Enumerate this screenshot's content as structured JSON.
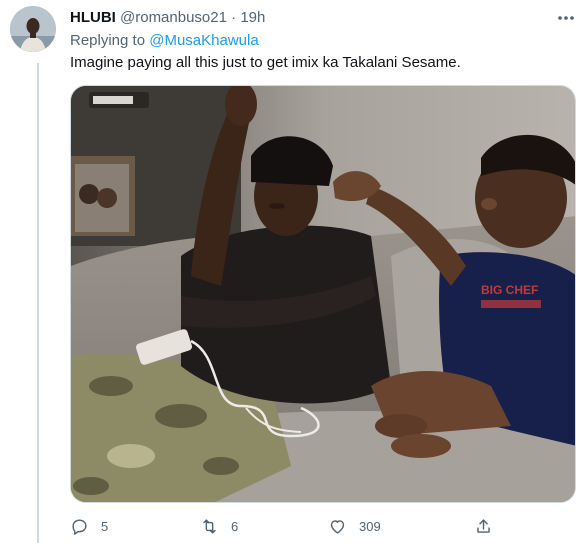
{
  "tweet": {
    "display_name": "HLUBI",
    "handle": "@romanbuso21",
    "separator": "·",
    "time": "19h",
    "replying_prefix": "Replying to",
    "replying_to": "@MusaKhawula",
    "text": "Imagine paying all this just to get imix ka Takalani Sesame.",
    "media_icon": "video-frame"
  },
  "actions": {
    "reply_icon": "reply-icon",
    "reply_count": "5",
    "retweet_icon": "retweet-icon",
    "retweet_count": "6",
    "like_icon": "heart-icon",
    "like_count": "309",
    "share_icon": "share-icon"
  },
  "colors": {
    "accent": "#1d9bf0",
    "secondary_text": "#536471",
    "primary_text": "#0f1419",
    "divider": "#cfd9de"
  }
}
